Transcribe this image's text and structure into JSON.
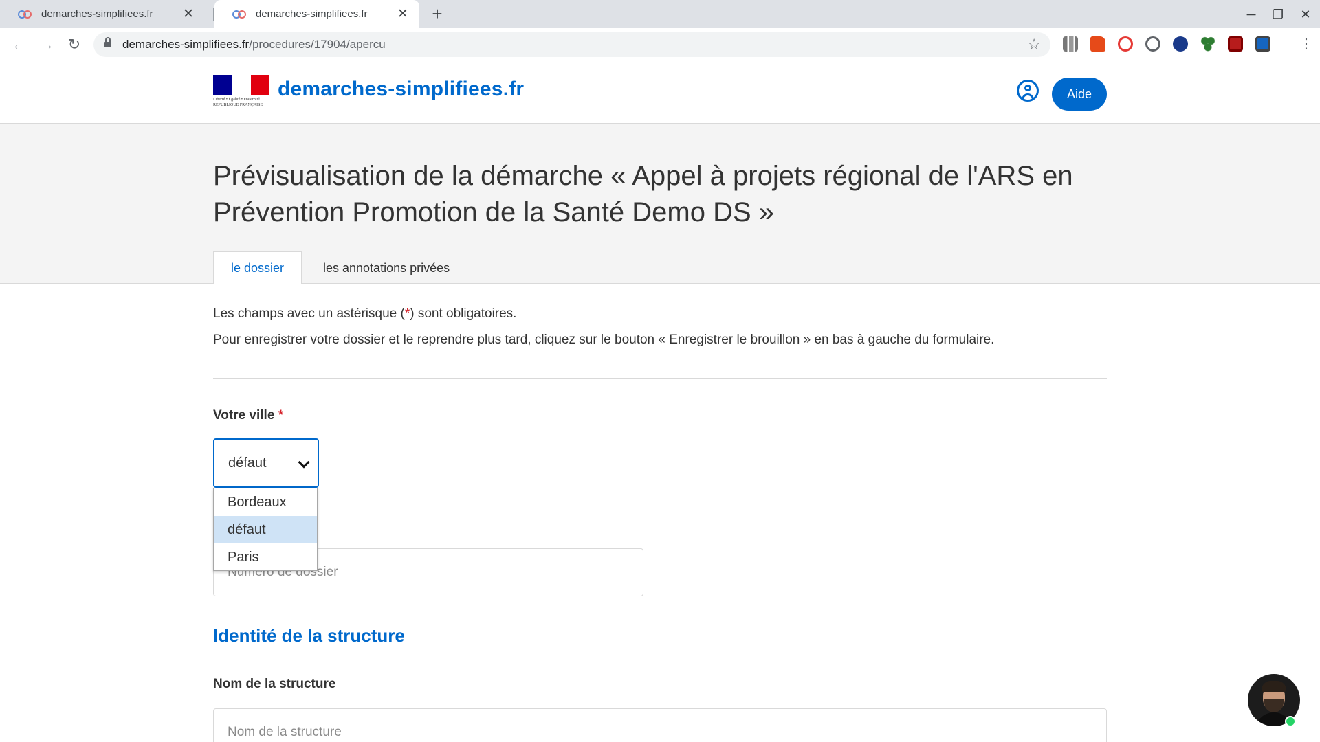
{
  "browser": {
    "tabs": [
      {
        "title": "demarches-simplifiees.fr",
        "active": false
      },
      {
        "title": "demarches-simplifiees.fr",
        "active": true
      }
    ],
    "url_host": "demarches-simplifiees.fr",
    "url_path": "/procedures/17904/apercu",
    "extension_icons": [
      "library-ext-icon",
      "office-ext-icon",
      "sync-ext-icon",
      "globe-ext-icon",
      "privacy-ext-icon",
      "clover-ext-icon",
      "gift-ext-icon",
      "screenshot-ext-icon"
    ]
  },
  "header": {
    "logo_motto": "Liberté • Égalité • Fraternité",
    "logo_country": "RÉPUBLIQUE FRANÇAISE",
    "site_name": "demarches-simplifiees.fr",
    "help_label": "Aide"
  },
  "page": {
    "title": "Prévisualisation de la démarche « Appel à projets régional de l'ARS en Prévention Promotion de la Santé Demo DS »",
    "tabs": [
      {
        "label": "le dossier",
        "active": true
      },
      {
        "label": "les annotations privées",
        "active": false
      }
    ]
  },
  "form": {
    "intro_1_before": "Les champs avec un astérisque (",
    "intro_1_star": "*",
    "intro_1_after": ") sont obligatoires.",
    "intro_2": "Pour enregistrer votre dossier et le reprendre plus tard, cliquez sur le bouton « Enregistrer le brouillon » en bas à gauche du formulaire.",
    "ville_label": "Votre ville",
    "required_mark": "*",
    "ville_value": "défaut",
    "ville_options": [
      {
        "label": "Bordeaux",
        "selected": false
      },
      {
        "label": "défaut",
        "selected": true
      },
      {
        "label": "Paris",
        "selected": false
      }
    ],
    "dossier_placeholder": "Numéro de dossier",
    "section_title": "Identité de la structure",
    "structure_label": "Nom de la structure",
    "structure_placeholder": "Nom de la structure"
  },
  "colors": {
    "brand_blue": "#0069cc",
    "required_red": "#d5212a",
    "selected_option": "#cfe3f6",
    "online_green": "#25d366"
  }
}
